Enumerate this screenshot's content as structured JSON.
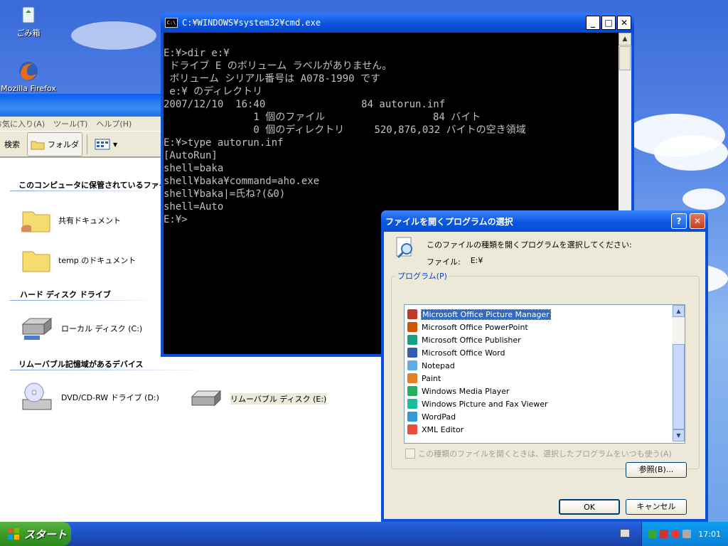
{
  "desktop": {
    "icons": [
      {
        "label": "ごみ箱"
      },
      {
        "label": "Mozilla Firefox"
      }
    ]
  },
  "explorer": {
    "menu": [
      "お気に入り(A)",
      "ツール(T)",
      "ヘルプ(H)"
    ],
    "toolbar": {
      "search": "検索",
      "folders": "フォルダ"
    },
    "groups": {
      "shared": "このコンピュータに保管されているファイル",
      "hdd": "ハード ディスク ドライブ",
      "removable": "リムーバブル記憶域があるデバイス"
    },
    "items": {
      "shared_docs": "共有ドキュメント",
      "temp_docs": "temp のドキュメント",
      "local_disk": "ローカル ディスク (C:)",
      "dvd": "DVD/CD-RW ドライブ (D:)",
      "removable_disk": "リムーバブル ディスク (E:)"
    }
  },
  "cmd": {
    "title": "C:¥WINDOWS¥system32¥cmd.exe",
    "lines": [
      "E:¥>dir e:¥",
      " ドライブ E のボリューム ラベルがありません。",
      " ボリューム シリアル番号は A078-1990 です",
      "",
      " e:¥ のディレクトリ",
      "",
      "2007/12/10  16:40                84 autorun.inf",
      "               1 個のファイル                  84 バイト",
      "               0 個のディレクトリ     520,876,032 バイトの空き領域",
      "",
      "E:¥>type autorun.inf",
      "[AutoRun]",
      "shell=baka",
      "shell¥baka¥command=aho.exe",
      "shell¥baka|=氏ね?(&0)",
      "shell=Auto",
      "E:¥>"
    ]
  },
  "dialog": {
    "title": "ファイルを開くプログラムの選択",
    "prompt": "このファイルの種類を開くプログラムを選択してください:",
    "file_label": "ファイル:",
    "file_value": "E:¥",
    "programs_label": "プログラム(P)",
    "programs": [
      {
        "name": "Microsoft Office Picture Manager",
        "selected": true,
        "color": "#c0392b"
      },
      {
        "name": "Microsoft Office PowerPoint",
        "selected": false,
        "color": "#d35400"
      },
      {
        "name": "Microsoft Office Publisher",
        "selected": false,
        "color": "#16a085"
      },
      {
        "name": "Microsoft Office Word",
        "selected": false,
        "color": "#2e5fb0"
      },
      {
        "name": "Notepad",
        "selected": false,
        "color": "#5dade2"
      },
      {
        "name": "Paint",
        "selected": false,
        "color": "#e67e22"
      },
      {
        "name": "Windows Media Player",
        "selected": false,
        "color": "#27ae60"
      },
      {
        "name": "Windows Picture and Fax Viewer",
        "selected": false,
        "color": "#1abc9c"
      },
      {
        "name": "WordPad",
        "selected": false,
        "color": "#3498db"
      },
      {
        "name": "XML Editor",
        "selected": false,
        "color": "#e74c3c"
      }
    ],
    "always_use": "この種類のファイルを開くときは、選択したプログラムをいつも使う(A)",
    "browse": "参照(B)...",
    "ok": "OK",
    "cancel": "キャンセル"
  },
  "taskbar": {
    "start": "スタート",
    "clock": "17:01"
  }
}
